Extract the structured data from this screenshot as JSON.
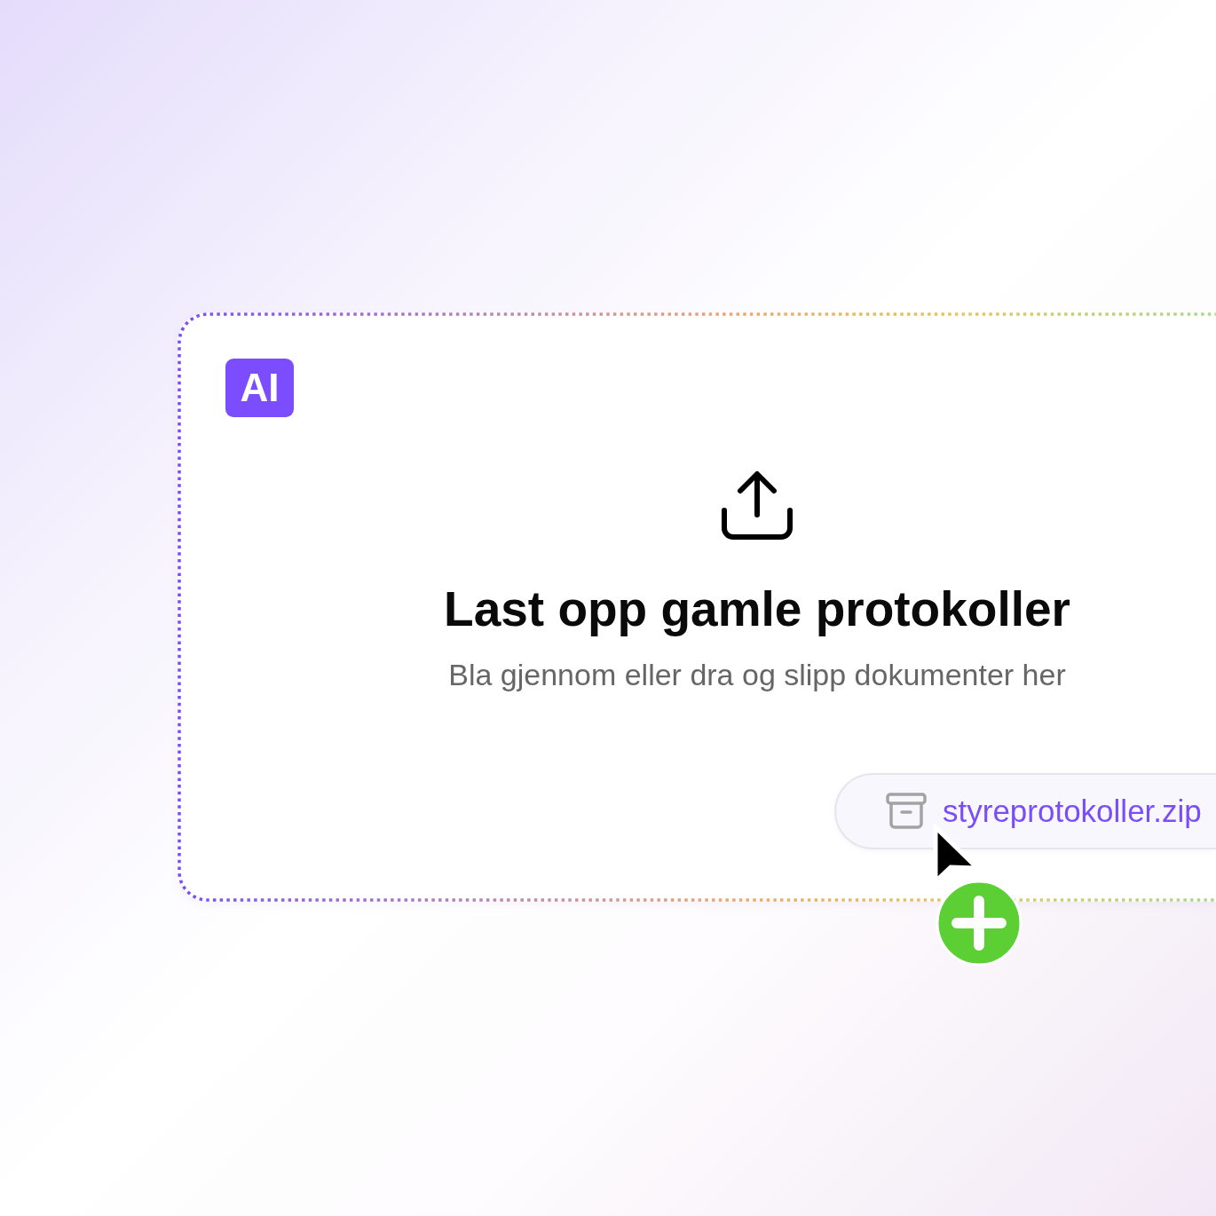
{
  "badge": {
    "text": "AI"
  },
  "dropzone": {
    "title": "Last opp gamle protokoller",
    "subtitle": "Bla gjennom eller dra og slipp dokumenter her"
  },
  "dragged_file": {
    "name": "styreprotokoller.zip"
  }
}
